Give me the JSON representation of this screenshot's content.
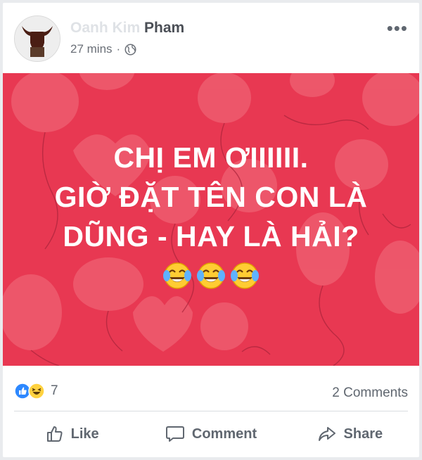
{
  "post": {
    "author_faded": "Oanh Kim ",
    "author": "Pham",
    "time": "27 mins",
    "separator": "·",
    "privacy_icon": "globe-icon",
    "more_icon": "more-options-icon"
  },
  "banner": {
    "line1": "CHỊ EM ƠIIIIII.",
    "line2": "GIỜ ĐẶT TÊN CON LÀ",
    "line3": "DŨNG - HAY LÀ HẢI?",
    "emoji": "😂",
    "background_color": "#e83852"
  },
  "stats": {
    "reaction_icons": [
      "like-reaction-icon",
      "haha-reaction-icon"
    ],
    "reaction_count": "7",
    "comments": "2 Comments"
  },
  "actions": {
    "like": "Like",
    "comment": "Comment",
    "share": "Share"
  }
}
